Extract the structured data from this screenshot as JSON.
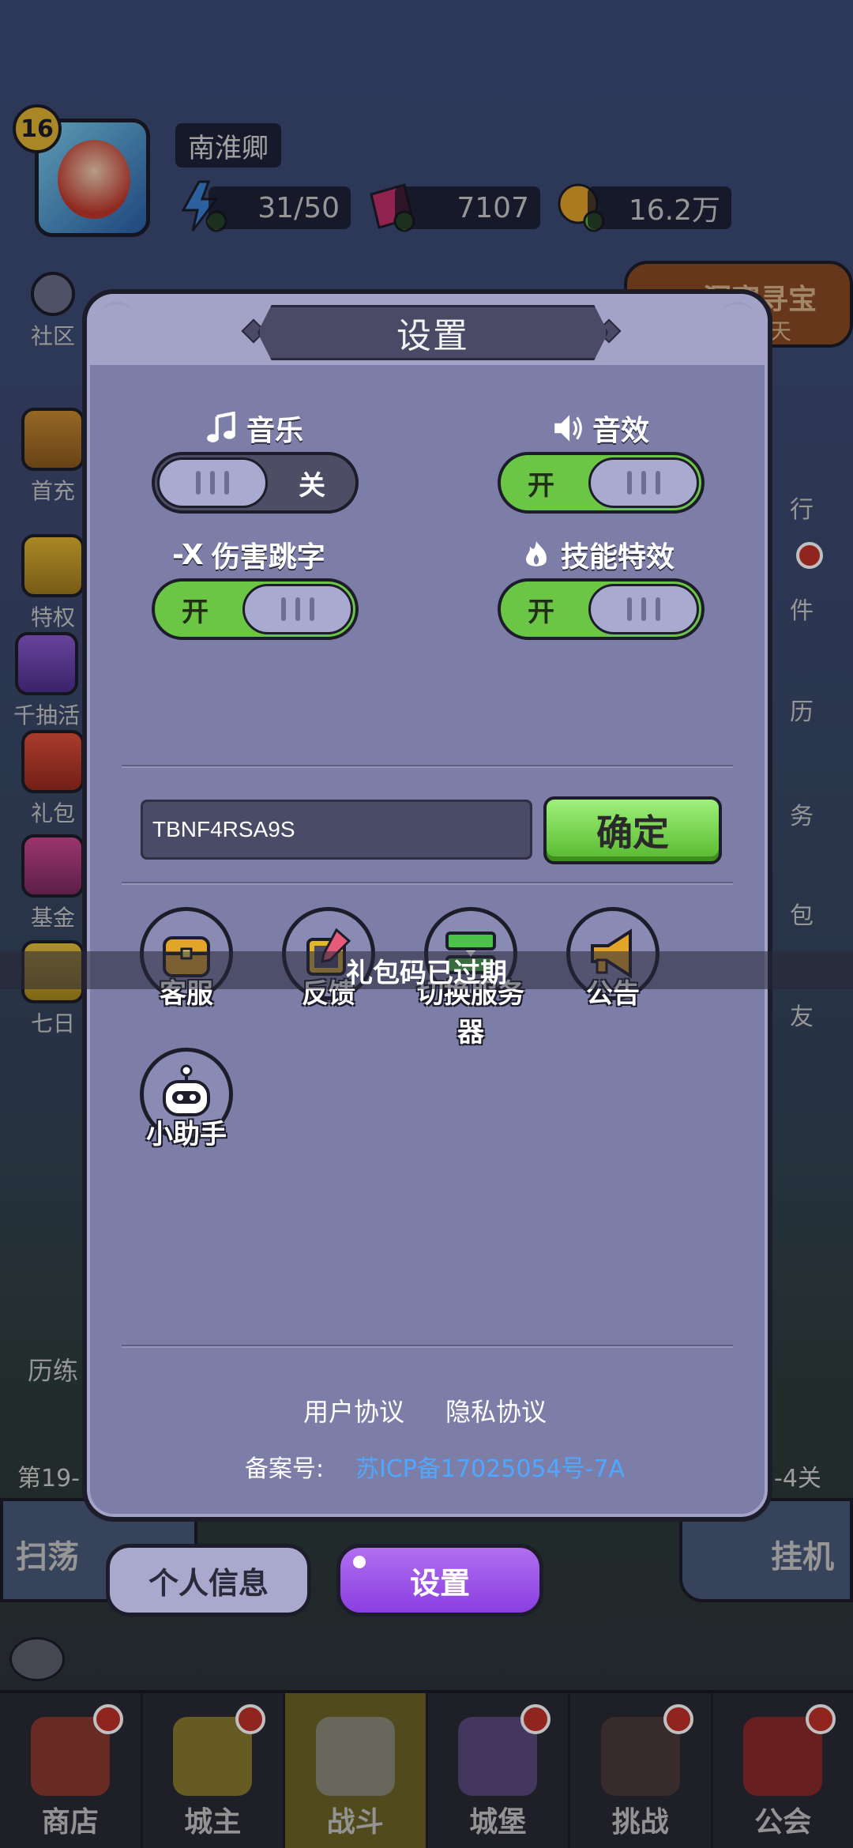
{
  "hud": {
    "level": "16",
    "player_name": "南淮卿",
    "energy": "31/50",
    "gems": "7107",
    "coins": "16.2万"
  },
  "side_left": [
    "社区",
    "首充",
    "特权",
    "千抽活",
    "礼包",
    "基金",
    "七日",
    "历练"
  ],
  "side_right": [
    "天",
    "行",
    "件",
    "历",
    "务",
    "包",
    "友"
  ],
  "event_banner": "洞窟寻宝",
  "stage_left": "第19-",
  "stage_right": "-4关",
  "behind_buttons": {
    "sweep": "扫荡",
    "idle": "挂机"
  },
  "modal": {
    "title": "设置",
    "settings": [
      {
        "label": "音乐",
        "state": "关",
        "on": false,
        "icon": "music-note-icon"
      },
      {
        "label": "音效",
        "state": "开",
        "on": true,
        "icon": "speaker-icon"
      },
      {
        "label": "伤害跳字",
        "state": "开",
        "on": true,
        "icon": "damage-number-icon",
        "icon_text": "-X"
      },
      {
        "label": "技能特效",
        "state": "开",
        "on": true,
        "icon": "flame-icon"
      }
    ],
    "gift_code": {
      "value": "TBNF4RSA9S",
      "confirm": "确定"
    },
    "functions": [
      {
        "label": "客服",
        "icon": "treasure-chest-icon"
      },
      {
        "label": "反馈",
        "icon": "pencil-note-icon"
      },
      {
        "label": "切换服务器",
        "icon": "server-switch-icon"
      },
      {
        "label": "公告",
        "icon": "megaphone-icon"
      },
      {
        "label": "小助手",
        "icon": "robot-icon"
      }
    ],
    "links": {
      "user_agreement": "用户协议",
      "privacy": "隐私协议"
    },
    "icp": {
      "label": "备案号:",
      "value": "苏ICP备17025054号-7A"
    }
  },
  "toast": "礼包码已过期",
  "panel_tabs": {
    "profile": "个人信息",
    "settings": "设置"
  },
  "bottom_tabs": [
    {
      "label": "商店",
      "badge": true
    },
    {
      "label": "城主",
      "badge": true
    },
    {
      "label": "战斗",
      "badge": false,
      "active": true
    },
    {
      "label": "城堡",
      "badge": true
    },
    {
      "label": "挑战",
      "badge": true
    },
    {
      "label": "公会",
      "badge": true
    }
  ],
  "colors": {
    "toggle_on": "#6cc646",
    "confirm_green": "#57b82e",
    "active_tab": "#8a3fe0",
    "icp_link": "#4fa8ff"
  }
}
